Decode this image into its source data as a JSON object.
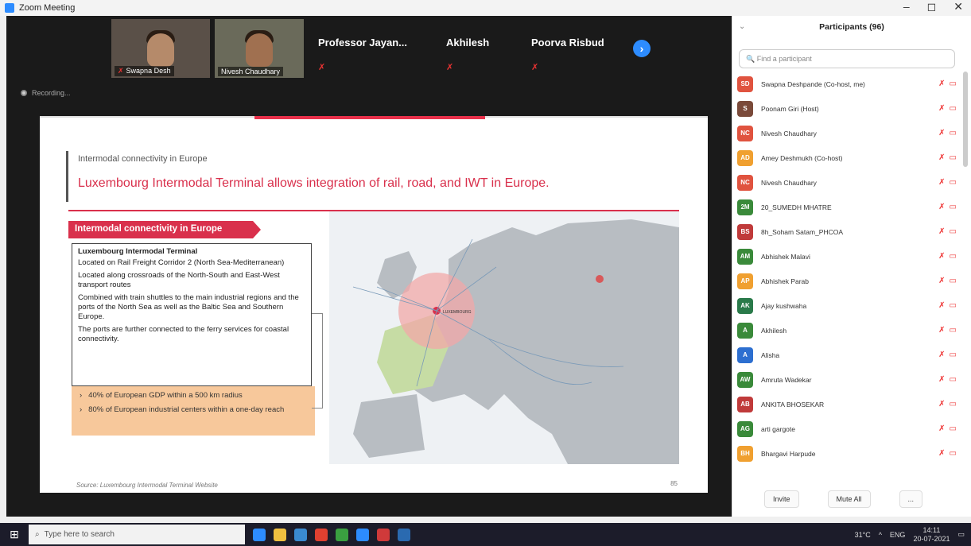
{
  "window": {
    "title": "Zoom Meeting",
    "controls": [
      "–",
      "◻",
      "✕"
    ]
  },
  "gallery": {
    "video_tiles": [
      {
        "name": "Swapna Desh"
      },
      {
        "name": "Nivesh Chaudhary"
      }
    ],
    "name_tiles": [
      {
        "name": "Professor Jayan..."
      },
      {
        "name": "Akhilesh"
      },
      {
        "name": "Poorva Risbud"
      }
    ],
    "next_icon": "chevron-right-icon"
  },
  "recording": {
    "label": "Recording..."
  },
  "slide": {
    "section": "Intermodal connectivity in Europe",
    "headline": "Luxembourg Intermodal Terminal allows integration of rail, road, and IWT in Europe.",
    "box_header": "Intermodal connectivity in Europe",
    "box_title": "Luxembourg Intermodal Terminal",
    "points": [
      "Located on Rail Freight Corridor 2 (North Sea-Mediterranean)",
      "Located along crossroads of the North-South and East-West transport routes",
      "Combined with train shuttles to the main industrial regions and the ports of the North Sea as well as the Baltic Sea and Southern Europe.",
      "The ports are further connected to the ferry services for coastal connectivity."
    ],
    "highlights": [
      "40% of European GDP within a 500 km radius",
      "80% of European industrial centers within a one-day reach"
    ],
    "map_hub_label": "LUXEMBOURG",
    "source": "Source: Luxembourg Intermodal Terminal Website",
    "page_number": "85"
  },
  "participants": {
    "title": "Participants (96)",
    "search_placeholder": "Find a participant",
    "list": [
      {
        "initials": "SD",
        "name": "Swapna Deshpande (Co-host, me)",
        "color": "#e0533f"
      },
      {
        "initials": "S",
        "name": "Poonam Giri (Host)",
        "color": "#7a4a3a"
      },
      {
        "initials": "NC",
        "name": "Nivesh Chaudhary",
        "color": "#e0533f"
      },
      {
        "initials": "AD",
        "name": "Amey Deshmukh (Co-host)",
        "color": "#f0a030"
      },
      {
        "initials": "NC",
        "name": "Nivesh Chaudhary",
        "color": "#e0533f"
      },
      {
        "initials": "2M",
        "name": "20_SUMEDH MHATRE",
        "color": "#3a8a3a"
      },
      {
        "initials": "BS",
        "name": "8h_Soham Satam_PHCOA",
        "color": "#c03a3a"
      },
      {
        "initials": "AM",
        "name": "Abhishek Malavi",
        "color": "#3a8a3a"
      },
      {
        "initials": "AP",
        "name": "Abhishek Parab",
        "color": "#f0a030"
      },
      {
        "initials": "AK",
        "name": "Ajay kushwaha",
        "color": "#2a7a4a"
      },
      {
        "initials": "A",
        "name": "Akhilesh",
        "color": "#3a8a3a"
      },
      {
        "initials": "A",
        "name": "Alisha",
        "color": "#2d6fd0"
      },
      {
        "initials": "AW",
        "name": "Amruta Wadekar",
        "color": "#3a8a3a"
      },
      {
        "initials": "AB",
        "name": "ANKITA BHOSEKAR",
        "color": "#c03a3a"
      },
      {
        "initials": "AG",
        "name": "arti gargote",
        "color": "#3a8a3a"
      },
      {
        "initials": "BH",
        "name": "Bhargavi Harpude",
        "color": "#f0a030"
      }
    ],
    "invite_label": "Invite",
    "mute_all_label": "Mute All",
    "more_label": "..."
  },
  "taskbar": {
    "search_placeholder": "Type here to search",
    "weather": "31°C",
    "lang": "ENG",
    "time": "14:11",
    "date": "20-07-2021"
  }
}
